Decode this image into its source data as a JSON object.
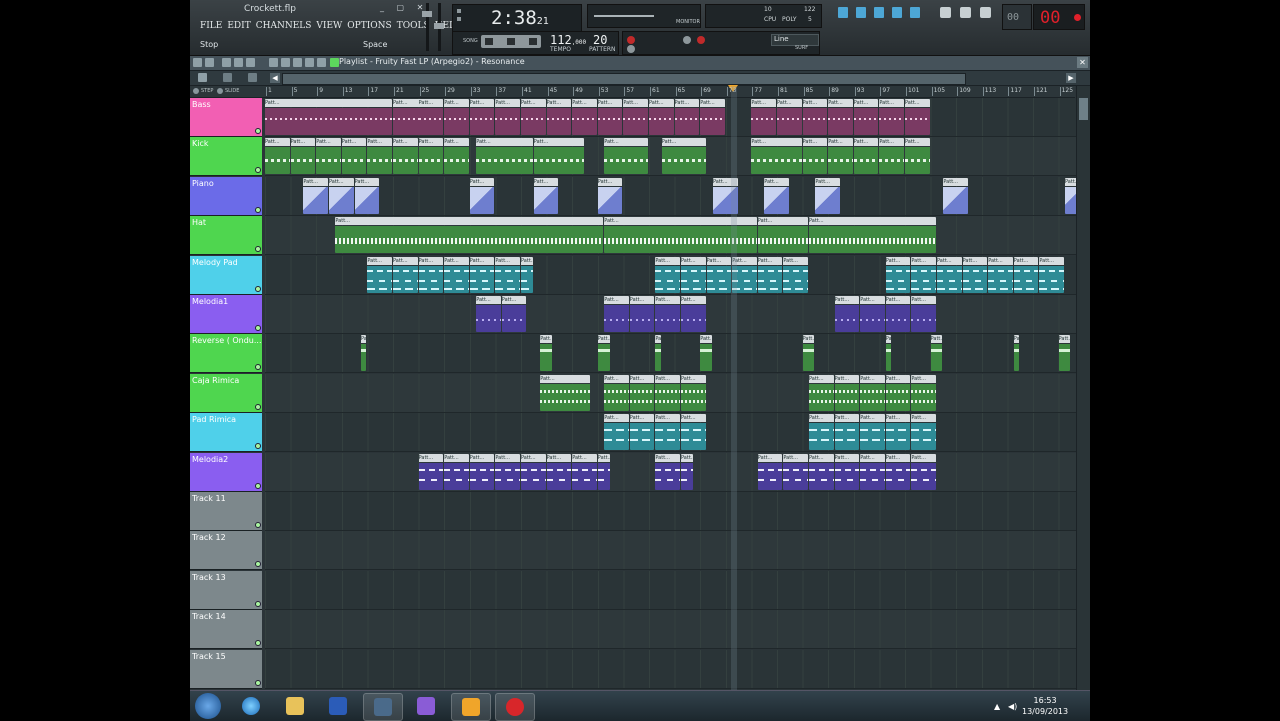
{
  "window": {
    "filename": "Crockett.flp",
    "controls": [
      "_",
      "▢",
      "✕"
    ]
  },
  "menu": [
    "FILE",
    "EDIT",
    "CHANNELS",
    "VIEW",
    "OPTIONS",
    "TOOLS",
    "HELP"
  ],
  "hint": {
    "left": "Stop",
    "right": "Space"
  },
  "time": {
    "main": "2:38",
    "frac": "21"
  },
  "transport": {
    "mode_label": "SONG",
    "tempo": "112",
    "tempo_frac": ",000",
    "tempo_label": "TEMPO",
    "pattern": "20",
    "pattern_label": "PATTERN"
  },
  "monitor_label": "MONITOR",
  "cpu": {
    "voices": "10",
    "cpu_label": "CPU",
    "poly_label": "POLY",
    "ram": "122",
    "poly": "5"
  },
  "snap": {
    "value": "Line",
    "surf_label": "SURF"
  },
  "counter": {
    "small": "00",
    "big": "00"
  },
  "playlist": {
    "title": "Playlist - Fruity Fast LP (Arpegio2) - Resonance",
    "step_label": "STEP",
    "slide_label": "SLIDE",
    "close": "✕",
    "left_arrow": "◀",
    "right_arrow": "▶"
  },
  "clip_label": "Patt...",
  "ruler": [
    "1",
    "5",
    "9",
    "13",
    "17",
    "21",
    "25",
    "29",
    "33",
    "37",
    "41",
    "45",
    "49",
    "53",
    "57",
    "61",
    "65",
    "69",
    "73",
    "77",
    "81",
    "85",
    "89",
    "93",
    "97",
    "101",
    "105",
    "109",
    "113",
    "117",
    "121",
    "125"
  ],
  "tracks": [
    {
      "name": "Bass",
      "color": "#f25fb3",
      "clip_color": "#7a3a63",
      "kind": "pink"
    },
    {
      "name": "Kick",
      "color": "#4fd64f",
      "clip_color": "#3e8a40",
      "kind": "green"
    },
    {
      "name": "Piano",
      "color": "#6b6be8",
      "clip_color": "#6e7ecf",
      "kind": "piano"
    },
    {
      "name": "Hat",
      "color": "#4fd64f",
      "clip_color": "#3e8a40",
      "kind": "hat"
    },
    {
      "name": "Melody Pad",
      "color": "#4fd0ea",
      "clip_color": "#2e8b96",
      "kind": "cyan"
    },
    {
      "name": "Melodia1",
      "color": "#8a5ef0",
      "clip_color": "#4a3d9a",
      "kind": "purple"
    },
    {
      "name": "Reverse ( Ondu...",
      "color": "#4fd64f",
      "clip_color": "#3e8a40",
      "kind": "rev"
    },
    {
      "name": "Caja Rimica",
      "color": "#4fd64f",
      "clip_color": "#3e8a40",
      "kind": "green2"
    },
    {
      "name": "Pad Rimica",
      "color": "#4fd0ea",
      "clip_color": "#2e8b96",
      "kind": "cyan2"
    },
    {
      "name": "Melodia2",
      "color": "#8a5ef0",
      "clip_color": "#4a3d9a",
      "kind": "purple2"
    },
    {
      "name": "Track 11",
      "color": "#7d888c",
      "clip_color": "",
      "kind": "empty"
    },
    {
      "name": "Track 12",
      "color": "#7d888c",
      "clip_color": "",
      "kind": "empty"
    },
    {
      "name": "Track 13",
      "color": "#7d888c",
      "clip_color": "",
      "kind": "empty"
    },
    {
      "name": "Track 14",
      "color": "#7d888c",
      "clip_color": "",
      "kind": "empty"
    },
    {
      "name": "Track 15",
      "color": "#7d888c",
      "clip_color": "",
      "kind": "empty"
    }
  ],
  "taskbar": {
    "time": "16:53",
    "date": "13/09/2013"
  }
}
